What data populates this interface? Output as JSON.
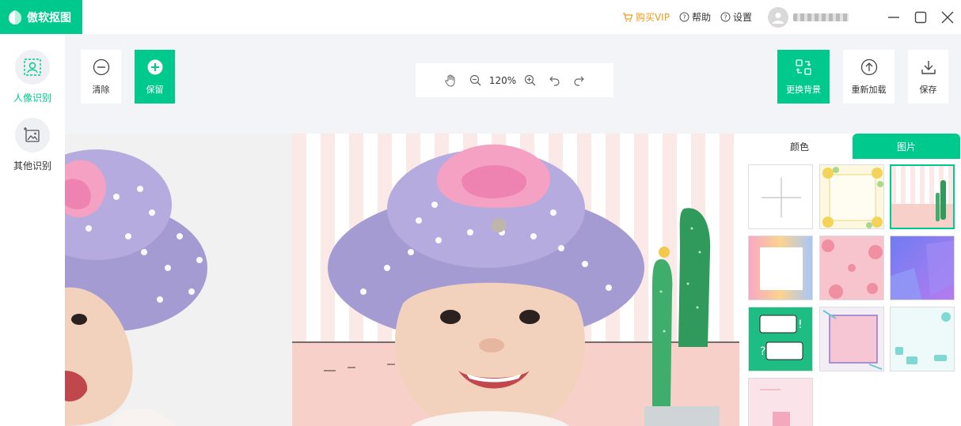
{
  "app": {
    "title": "傲软抠图"
  },
  "titlebar": {
    "vip_label": "购买VIP",
    "help_label": "帮助",
    "settings_label": "设置",
    "vip_color": "#f19a1e"
  },
  "sidebar": {
    "items": [
      {
        "label": "人像识别",
        "icon": "portrait-icon",
        "active": true
      },
      {
        "label": "其他识别",
        "icon": "image-plus-icon",
        "active": false
      }
    ]
  },
  "toolbar": {
    "clear_label": "清除",
    "keep_label": "保留",
    "zoom_value": "120%",
    "change_bg_label": "更换背景",
    "reload_label": "重新加载",
    "save_label": "保存"
  },
  "bg_panel": {
    "tab_color_label": "颜色",
    "tab_image_label": "图片",
    "active_tab": "图片",
    "thumbnails": [
      "add",
      "floral-frame",
      "cactus-stripes",
      "pink-card",
      "pink-roses",
      "purple-geometric",
      "green-speech",
      "pink-frame",
      "mint-shapes",
      "pink-product"
    ],
    "selected_index": 2
  },
  "colors": {
    "accent": "#00c98d",
    "background": "#f3f4f8"
  }
}
